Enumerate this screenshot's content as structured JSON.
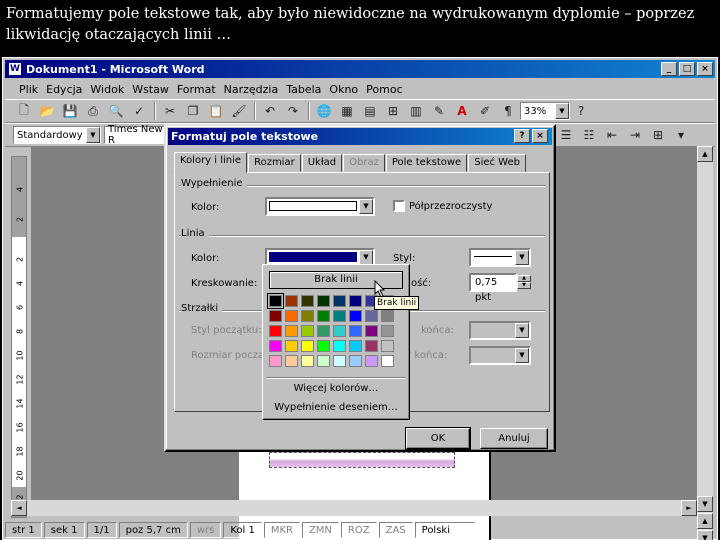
{
  "caption": "Formatujemy pole tekstowe tak, aby było niewidoczne na wydrukowanym dyplomie – poprzez likwidację otaczających linii …",
  "window": {
    "title": "Dokument1 - Microsoft Word",
    "icon": "W"
  },
  "menu": [
    "Plik",
    "Edycja",
    "Widok",
    "Wstaw",
    "Format",
    "Narzędzia",
    "Tabela",
    "Okno",
    "Pomoc"
  ],
  "toolbar": {
    "zoom": "33%",
    "style": "Standardowy",
    "font": "Times New R"
  },
  "ruler": [
    "4",
    "2",
    "2",
    "4",
    "6",
    "8",
    "10",
    "12",
    "14",
    "16",
    "18",
    "20",
    "22"
  ],
  "status": {
    "page": "str 1",
    "section": "sek 1",
    "pages": "1/1",
    "pos": "poz 5,7 cm",
    "line": "wrs",
    "col": "Kol 1",
    "mkr": "MKR",
    "zmn": "ZMN",
    "roz": "ROZ",
    "zas": "ZAS",
    "lang": "Polski"
  },
  "dialog": {
    "title": "Formatuj pole tekstowe",
    "tabs": [
      {
        "label": "Kolory i linie"
      },
      {
        "label": "Rozmiar"
      },
      {
        "label": "Układ"
      },
      {
        "label": "Obraz"
      },
      {
        "label": "Pole tekstowe"
      },
      {
        "label": "Sieć Web"
      }
    ],
    "fill_group": "Wypełnienie",
    "fill_color_label": "Kolor:",
    "semi_transparent": "Półprzezroczysty",
    "line_group": "Linia",
    "line_color_label": "Kolor:",
    "dashed_label": "Kreskowanie:",
    "style_label": "Styl:",
    "weight_label": "ość:",
    "weight_value": "0,75 pkt",
    "arrows_group": "Strzałki",
    "begin_style": "Styl początku:",
    "begin_size": "Rozmiar począt",
    "end_style": "końca:",
    "end_size": "ar końca:",
    "ok": "OK",
    "cancel": "Anuluj"
  },
  "palette": {
    "no_line": "Brak linii",
    "more_colors": "Więcej kolorów…",
    "patterns": "Wypełnienie deseniem…",
    "tooltip": "Brak linii",
    "colors": [
      "#000000",
      "#993300",
      "#333300",
      "#003300",
      "#003366",
      "#000080",
      "#333399",
      "#333333",
      "#800000",
      "#ff6600",
      "#808000",
      "#008000",
      "#008080",
      "#0000ff",
      "#666699",
      "#808080",
      "#ff0000",
      "#ff9900",
      "#99cc00",
      "#339966",
      "#33cccc",
      "#3366ff",
      "#800080",
      "#969696",
      "#ff00ff",
      "#ffcc00",
      "#ffff00",
      "#00ff00",
      "#00ffff",
      "#00ccff",
      "#993366",
      "#c0c0c0",
      "#ff99cc",
      "#ffcc99",
      "#ffff99",
      "#ccffcc",
      "#ccffff",
      "#99ccff",
      "#cc99ff",
      "#ffffff"
    ]
  }
}
